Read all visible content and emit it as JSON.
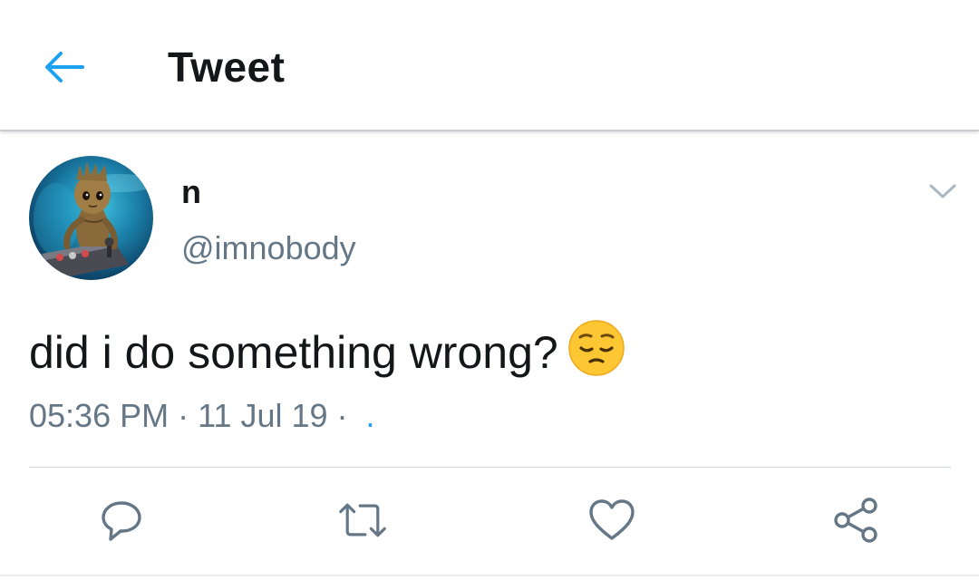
{
  "header": {
    "title": "Tweet",
    "back_icon": "back-arrow-icon"
  },
  "author": {
    "display_name": "n",
    "handle": "@imnobody",
    "avatar_icon": "avatar-groot-image"
  },
  "tweet": {
    "text": "did i do something wrong?",
    "emoji_icon": "pensive-face-emoji",
    "time": "05:36 PM",
    "separator": "·",
    "date": "11 Jul 19",
    "source_separator": "·",
    "source": "."
  },
  "actions": {
    "icons": [
      "reply-icon",
      "retweet-icon",
      "like-icon",
      "share-icon"
    ]
  },
  "colors": {
    "accent": "#1da1f2",
    "primary_text": "#14171a",
    "secondary_text": "#657786",
    "icon_gray": "#657786"
  }
}
